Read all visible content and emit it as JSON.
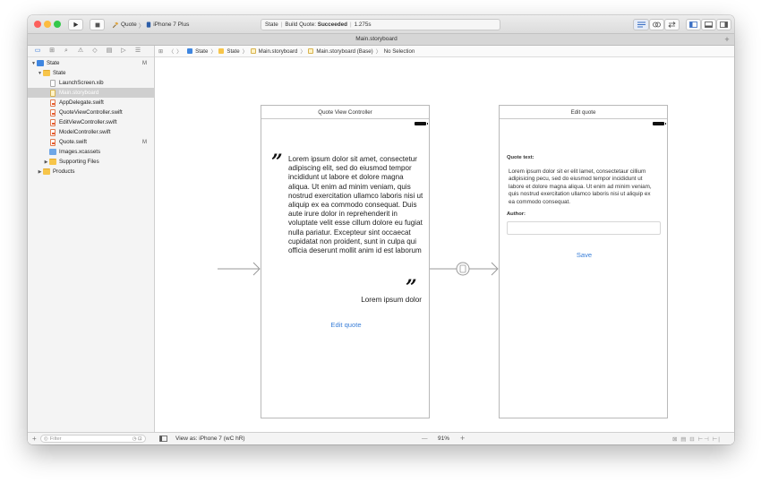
{
  "toolbar": {
    "scheme_target": "Quote",
    "scheme_device": "iPhone 7 Plus",
    "status_project": "State",
    "status_action": "Build Quote:",
    "status_result": "Succeeded",
    "status_time": "1.275s"
  },
  "tab": {
    "title": "Main.storyboard"
  },
  "navigator": {
    "items": [
      {
        "label": "State",
        "badge": "M"
      },
      {
        "label": "State"
      },
      {
        "label": "LaunchScreen.xib"
      },
      {
        "label": "Main.storyboard"
      },
      {
        "label": "AppDelegate.swift"
      },
      {
        "label": "QuoteViewController.swift"
      },
      {
        "label": "EditViewController.swift"
      },
      {
        "label": "ModelController.swift"
      },
      {
        "label": "Quote.swift",
        "badge": "M"
      },
      {
        "label": "Images.xcassets"
      },
      {
        "label": "Supporting Files"
      },
      {
        "label": "Products"
      }
    ],
    "filter_placeholder": "Filter"
  },
  "jumpbar": {
    "crumbs": [
      "State",
      "State",
      "Main.storyboard",
      "Main.storyboard (Base)",
      "No Selection"
    ]
  },
  "scenes": {
    "quote": {
      "title": "Quote View Controller",
      "quote_open": "”",
      "quote_close": "”",
      "text": "Lorem ipsum dolor sit amet, consectetur adipiscing elit, sed do eiusmod tempor incididunt ut labore et dolore magna aliqua. Ut enim ad minim veniam, quis nostrud exercitation ullamco laboris nisi ut aliquip ex ea commodo consequat. Duis aute irure dolor in reprehenderit in voluptate velit esse cillum dolore eu fugiat nulla pariatur. Excepteur sint occaecat cupidatat non proident, sunt in culpa qui officia deserunt mollit anim id est laborum",
      "author": "Lorem ipsum dolor",
      "edit_link": "Edit quote"
    },
    "edit": {
      "title": "Edit quote",
      "quote_label": "Quote text:",
      "quote_text": "Lorem ipsum dolor sit er elit lamet, consectetaur cillium adipisicing pecu, sed do eiusmod tempor incididunt ut labore et dolore magna aliqua. Ut enim ad minim veniam, quis nostrud exercitation ullamco laboris nisi ut aliquip ex ea commodo consequat.",
      "author_label": "Author:",
      "save_link": "Save"
    }
  },
  "bottom": {
    "view_as": "View as: iPhone 7 (wC hR)",
    "zoom": "91%",
    "zoom_out": "—",
    "zoom_in": "+"
  },
  "colors": {
    "accent": "#3a7fd8",
    "close": "#fc605c",
    "minimize": "#fdbc40",
    "zoom": "#34c84a"
  }
}
